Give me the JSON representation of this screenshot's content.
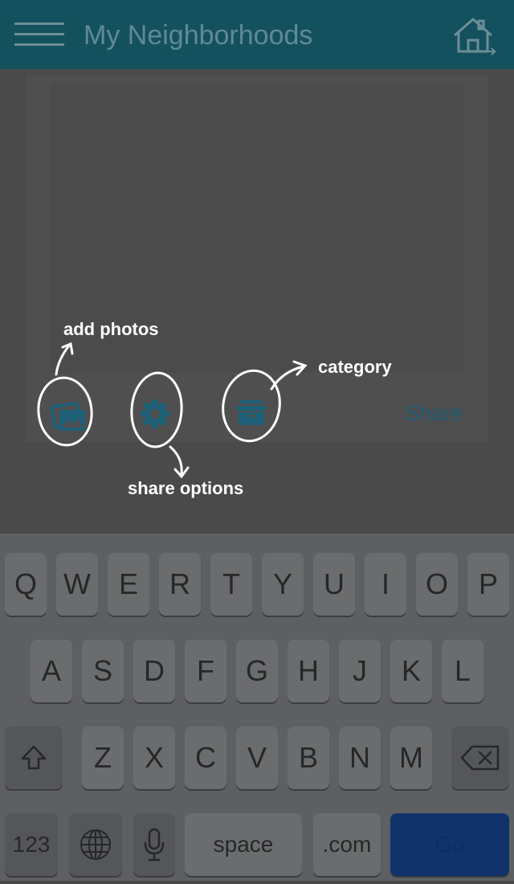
{
  "header": {
    "title": "My Neighborhoods"
  },
  "post": {
    "share_label": "Share"
  },
  "annotations": {
    "add_photos": "add photos",
    "category": "category",
    "share_options": "share options"
  },
  "keyboard": {
    "row1": [
      "Q",
      "W",
      "E",
      "R",
      "T",
      "Y",
      "U",
      "I",
      "O",
      "P"
    ],
    "row2": [
      "A",
      "S",
      "D",
      "F",
      "G",
      "H",
      "J",
      "K",
      "L"
    ],
    "row3": [
      "Z",
      "X",
      "C",
      "V",
      "B",
      "N",
      "M"
    ],
    "numbers_key": "123",
    "space_key": "space",
    "dotcom_key": ".com",
    "go_key": "Go"
  }
}
